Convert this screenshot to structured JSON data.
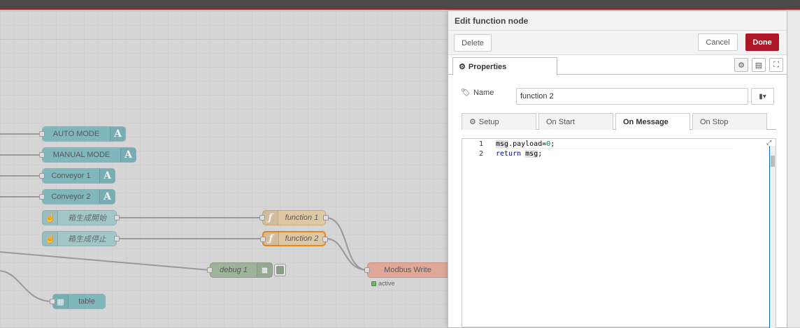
{
  "workspace": {
    "nodes": {
      "auto_mode": "AUTO MODE",
      "manual_mode": "MANUAL MODE",
      "conveyor1": "Conveyor 1",
      "conveyor2": "Conveyor 2",
      "inject_start": "箱生成開始",
      "inject_stop": "箱生成停止",
      "function1": "function 1",
      "function2": "function 2",
      "debug1": "debug 1",
      "modbus_write": "Modbus Write",
      "modbus_status": "active",
      "table": "table"
    }
  },
  "editor_panel": {
    "title": "Edit function node",
    "delete_label": "Delete",
    "cancel_label": "Cancel",
    "done_label": "Done",
    "properties_tab": "Properties",
    "name_label": "Name",
    "name_value": "function 2",
    "tabs": [
      "Setup",
      "On Start",
      "On Message",
      "On Stop"
    ],
    "active_tab": "On Message",
    "code": {
      "line1_num": "1",
      "line2_num": "2",
      "line1_a": "msg",
      "line1_b": ".payload=",
      "line1_c": "0",
      "line1_d": ";",
      "line2_a": "return",
      "line2_b": " ",
      "line2_c": "msg",
      "line2_d": ";"
    }
  },
  "colors": {
    "done": "#ad1625",
    "accent_border": "#a32424"
  },
  "icons": [
    "gear-icon",
    "tag-icon",
    "book-icon",
    "description-icon",
    "expand-icon",
    "hand-icon",
    "function-icon",
    "text-icon",
    "list-icon",
    "table-icon"
  ]
}
